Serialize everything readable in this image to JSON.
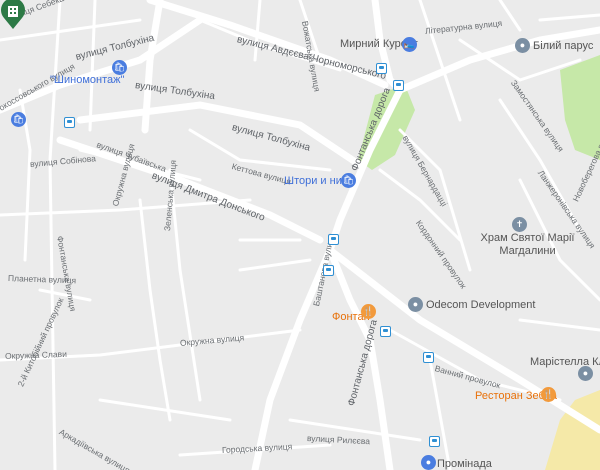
{
  "streets": {
    "tolbukhina_1": "вулиця Толбухіна",
    "tolbukhina_2": "вулиця Толбухіна",
    "tolbukhina_3": "вулиця Толбухіна",
    "avdeyeva": "вулиця Авдєєва-Чорноморського",
    "donskoho": "вулиця Дмитра Донського",
    "fontanska_1": "Фонтанська дорога",
    "fontanska_2": "Фонтанська дорога",
    "rokossovskoho": "Рокоссовського вулиця",
    "sebeka": "вулиця Себека",
    "chubaivska": "вулиця Чубаївська",
    "kettova": "Кеттова вулиця",
    "sobinova": "вулиця Собінова",
    "okruzhna": "Окружна вулиця",
    "okruzhna_2": "Окружна вулиця",
    "ryleeva": "вулиця Рилєєва",
    "horodska": "Городська вулиця",
    "vanna": "Ванний провулок",
    "bazhanova": "Баштанова вулиця",
    "zelenska": "Зеленська вулиця",
    "planetna": "Планетна вулиця",
    "fontanska_vul": "Фонтанська вулиця",
    "slavy": "Окружна Слави",
    "kytaibaivsky": "2-й Китобійний провулок",
    "arkadiyivska": "Аркадіївська вулиця",
    "literaturna": "Літературна вулиця",
    "zamostianska": "Замостянська вулиця",
    "bernardazzi": "вулиця Бернардацці",
    "koodynna": "Кордонний провулок",
    "vozhatska": "Вожатська вулиця",
    "lanzheronivska": "Ланжеронівська вулиця",
    "novoberehova": "Новоберегова вулиця"
  },
  "pois": {
    "shynomontazh": "\"Шиномонтаж\"",
    "myrny_kurort": "Мирний Курорт",
    "bily_parus": "Білий парус",
    "shtory": "Штори и нити",
    "khram": "Храм Святої Марії Магдалини",
    "odecom": "Odecom Development",
    "fontan": "Фонтан",
    "maristella": "Марістелла Клаб",
    "restoran_zebra": "Ресторан Зебра",
    "prominada": "Промінада"
  },
  "icons": {
    "marker": "building-marker-icon",
    "bus": "bus-stop-icon",
    "shop": "shopping-bag-icon",
    "lodging": "hotel-bed-icon",
    "restaurant": "restaurant-icon",
    "place": "place-pin-icon",
    "church": "church-icon"
  },
  "colors": {
    "land": "#ebebeb",
    "road": "#ffffff",
    "park": "#c6e8a8",
    "water": "#f5e9a8",
    "marker": "#2d7a46"
  }
}
